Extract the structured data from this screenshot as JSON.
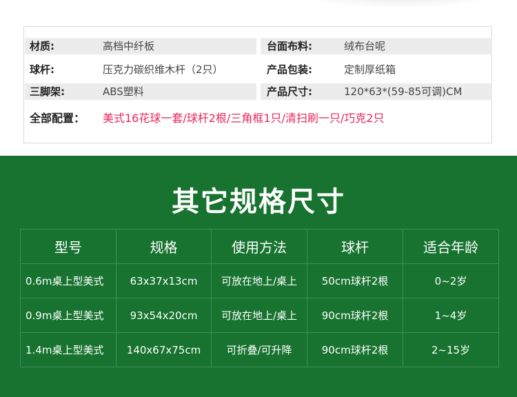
{
  "specs": {
    "rows": [
      {
        "l_label": "材质:",
        "l_value": "高档中纤板",
        "r_label": "台面布料:",
        "r_value": "绒布台呢"
      },
      {
        "l_label": "球杆:",
        "l_value": "压克力碳织维木杆（2只）",
        "r_label": "产品包装:",
        "r_value": "定制厚纸箱"
      },
      {
        "l_label": "三脚架:",
        "l_value": "ABS塑料",
        "r_label": "产品尺寸:",
        "r_value": "120*63*(59-85可调)CM"
      }
    ],
    "all_label": "全部配置：",
    "all_value": "美式16花球一套/球杆2根/三角框1只/清扫刷一只/巧克2只"
  },
  "section": {
    "title": "其它规格尺寸"
  },
  "table": {
    "headers": [
      "型号",
      "规格",
      "使用方法",
      "球杆",
      "适合年龄"
    ],
    "rows": [
      [
        "0.6m桌上型美式",
        "63x37x13cm",
        "可放在地上/桌上",
        "50cm球杆2根",
        "0~2岁"
      ],
      [
        "0.9m桌上型美式",
        "93x54x20cm",
        "可放在地上/桌上",
        "90cm球杆2根",
        "1~4岁"
      ],
      [
        "1.4m桌上型美式",
        "140x67x75cm",
        "可折叠/可升降",
        "90cm球杆2根",
        "2~15岁"
      ]
    ]
  },
  "colors": {
    "green_bg": "#17732f",
    "highlight_text": "#e8265b",
    "grey_row": "#ececec"
  }
}
